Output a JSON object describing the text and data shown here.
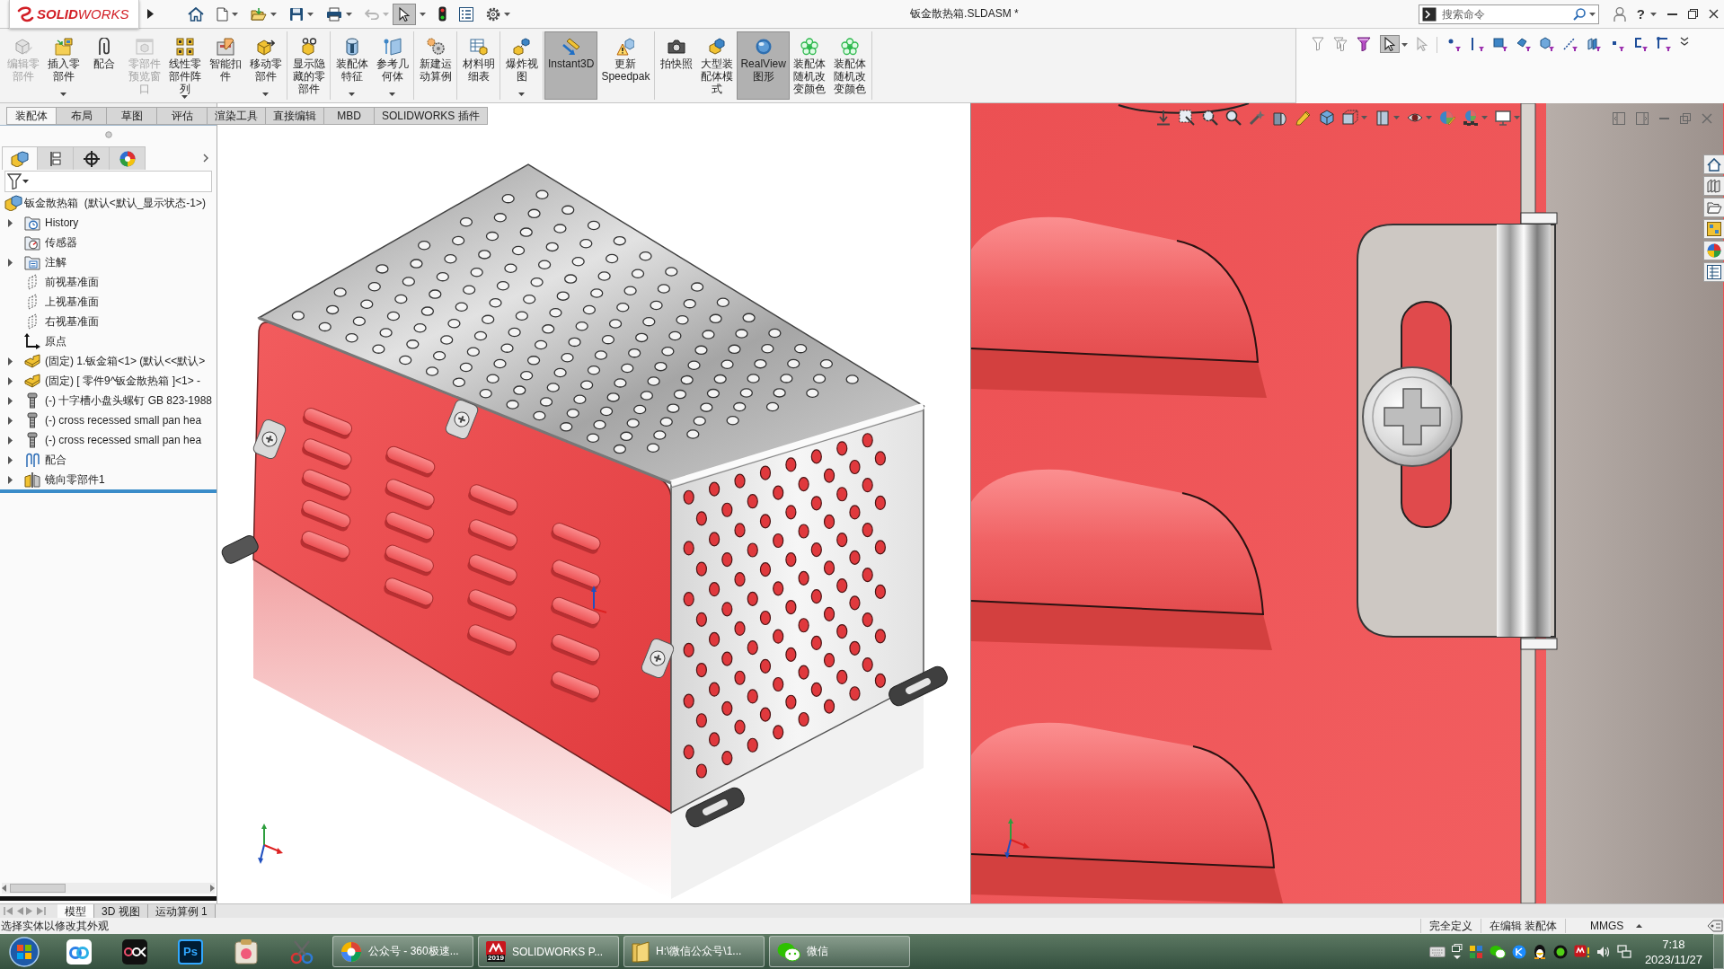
{
  "titlebar": {
    "logo": "**SOLID**WORKS",
    "title": "钣金散热箱.SLDASM *",
    "search": {
      "placeholder": "搜索命令"
    },
    "help": "?"
  },
  "quick_access": {
    "undo_disabled": true,
    "pointer_selected": true
  },
  "ribbon": {
    "groups": [
      {
        "buttons": [
          {
            "kind": "edit",
            "label": "编辑零部件",
            "disabled": true,
            "on": false,
            "has_menu": false
          },
          {
            "kind": "insert",
            "label": "插入零部件",
            "disabled": false,
            "on": false,
            "has_menu": true
          },
          {
            "kind": "mate",
            "label": "配合",
            "disabled": false,
            "on": false,
            "has_menu": false
          },
          {
            "kind": "preview",
            "label": "零部件预览窗口",
            "disabled": true,
            "on": false,
            "has_menu": false
          },
          {
            "kind": "pattern",
            "label": "线性零部件阵列",
            "disabled": false,
            "on": false,
            "has_menu": true
          },
          {
            "kind": "fastener",
            "label": "智能扣件",
            "disabled": false,
            "on": false,
            "has_menu": false
          },
          {
            "kind": "move",
            "label": "移动零部件",
            "disabled": false,
            "on": false,
            "has_menu": true
          }
        ]
      },
      {
        "buttons": [
          {
            "kind": "show",
            "label": "显示隐藏的零部件",
            "disabled": false,
            "on": false,
            "has_menu": false
          }
        ]
      },
      {
        "buttons": [
          {
            "kind": "features",
            "label": "装配体特征",
            "disabled": false,
            "on": false,
            "has_menu": true
          },
          {
            "kind": "reference",
            "label": "参考几何体",
            "disabled": false,
            "on": false,
            "has_menu": true
          }
        ]
      },
      {
        "buttons": [
          {
            "kind": "motion",
            "label": "新建运动算例",
            "disabled": false,
            "on": false,
            "has_menu": false
          }
        ]
      },
      {
        "buttons": [
          {
            "kind": "bom",
            "label": "材料明细表",
            "disabled": false,
            "on": false,
            "has_menu": false
          }
        ]
      },
      {
        "buttons": [
          {
            "kind": "explode",
            "label": "爆炸视图",
            "disabled": false,
            "on": false,
            "has_menu": true
          }
        ]
      },
      {
        "buttons": [
          {
            "kind": "instant3d",
            "label": "Instant3D",
            "disabled": false,
            "on": true,
            "has_menu": false
          },
          {
            "kind": "speedpak",
            "label": "更新Speedpak",
            "disabled": false,
            "on": false,
            "has_menu": false
          }
        ]
      },
      {
        "buttons": [
          {
            "kind": "snapshot",
            "label": "拍快照",
            "disabled": false,
            "on": false,
            "has_menu": false
          },
          {
            "kind": "large",
            "label": "大型装配体模式",
            "disabled": false,
            "on": false,
            "has_menu": false
          },
          {
            "kind": "realview",
            "label": "RealView图形",
            "disabled": false,
            "on": true,
            "has_menu": false
          },
          {
            "kind": "recolor",
            "label": "装配体随机改变颜色",
            "disabled": false,
            "on": false,
            "has_menu": false
          },
          {
            "kind": "recolor",
            "label": "装配体随机改变颜色",
            "disabled": false,
            "on": false,
            "has_menu": false
          }
        ]
      }
    ]
  },
  "ribbon_tabs": [
    {
      "label": "装配体",
      "selected": true
    },
    {
      "label": "布局",
      "selected": false
    },
    {
      "label": "草图",
      "selected": false
    },
    {
      "label": "评估",
      "selected": false
    },
    {
      "label": "渲染工具",
      "selected": false
    },
    {
      "label": "直接编辑",
      "selected": false
    },
    {
      "label": "MBD",
      "selected": false
    },
    {
      "label": "SOLIDWORKS 插件",
      "selected": false
    }
  ],
  "selection_toolbar": {
    "pointer_selected": true
  },
  "feature_manager": {
    "tabs": [
      {
        "selected": true
      },
      {
        "selected": false
      },
      {
        "selected": false
      },
      {
        "selected": false
      }
    ],
    "tree": {
      "label": "钣金散热箱  (默认<默认_显示状态-1>)",
      "kind": "assembly",
      "children": [
        {
          "label": "History",
          "kind": "history",
          "expandable": true
        },
        {
          "label": "传感器",
          "kind": "sensors",
          "expandable": false
        },
        {
          "label": "注解",
          "kind": "annotations",
          "expandable": true
        },
        {
          "label": "前视基准面",
          "kind": "plane",
          "expandable": false
        },
        {
          "label": "上视基准面",
          "kind": "plane",
          "expandable": false
        },
        {
          "label": "右视基准面",
          "kind": "plane",
          "expandable": false
        },
        {
          "label": "原点",
          "kind": "origin",
          "expandable": false
        },
        {
          "label": "(固定) 1.钣金箱<1> (默认<<默认>",
          "kind": "part",
          "expandable": true
        },
        {
          "label": "(固定) [ 零件9^钣金散热箱 ]<1> -",
          "kind": "part",
          "expandable": true
        },
        {
          "label": "(-) 十字槽小盘头螺钉 GB 823-1988",
          "kind": "screw",
          "expandable": true
        },
        {
          "label": "(-) cross recessed small pan hea",
          "kind": "screw",
          "expandable": true
        },
        {
          "label": "(-) cross recessed small pan hea",
          "kind": "screw",
          "expandable": true
        },
        {
          "label": "配合",
          "kind": "mates",
          "expandable": true
        },
        {
          "label": "镜向零部件1",
          "kind": "mirror",
          "expandable": true
        }
      ]
    }
  },
  "bottom_tabs": [
    {
      "label": "模型",
      "selected": true
    },
    {
      "label": "3D 视图",
      "selected": false
    },
    {
      "label": "运动算例 1",
      "selected": false
    }
  ],
  "status_bar": {
    "message": "选择实体以修改其外观",
    "fields": [
      {
        "label": "完全定义",
        "has_menu": false
      },
      {
        "label": "在编辑 装配体",
        "has_menu": false
      },
      {
        "label": "MMGS",
        "has_menu": true
      }
    ]
  },
  "taskbar": {
    "ps_label": "Ps",
    "windows": [
      {
        "kind": "browser",
        "label": "公众号 - 360极速..."
      },
      {
        "kind": "solidworks",
        "label": "SOLIDWORKS P...",
        "badge": "2019"
      },
      {
        "kind": "folder",
        "label": "H:\\微信公众号\\1..."
      },
      {
        "kind": "chat",
        "label": "微信"
      }
    ],
    "clock": {
      "time": "7:18",
      "date": "2023/11/27"
    }
  }
}
